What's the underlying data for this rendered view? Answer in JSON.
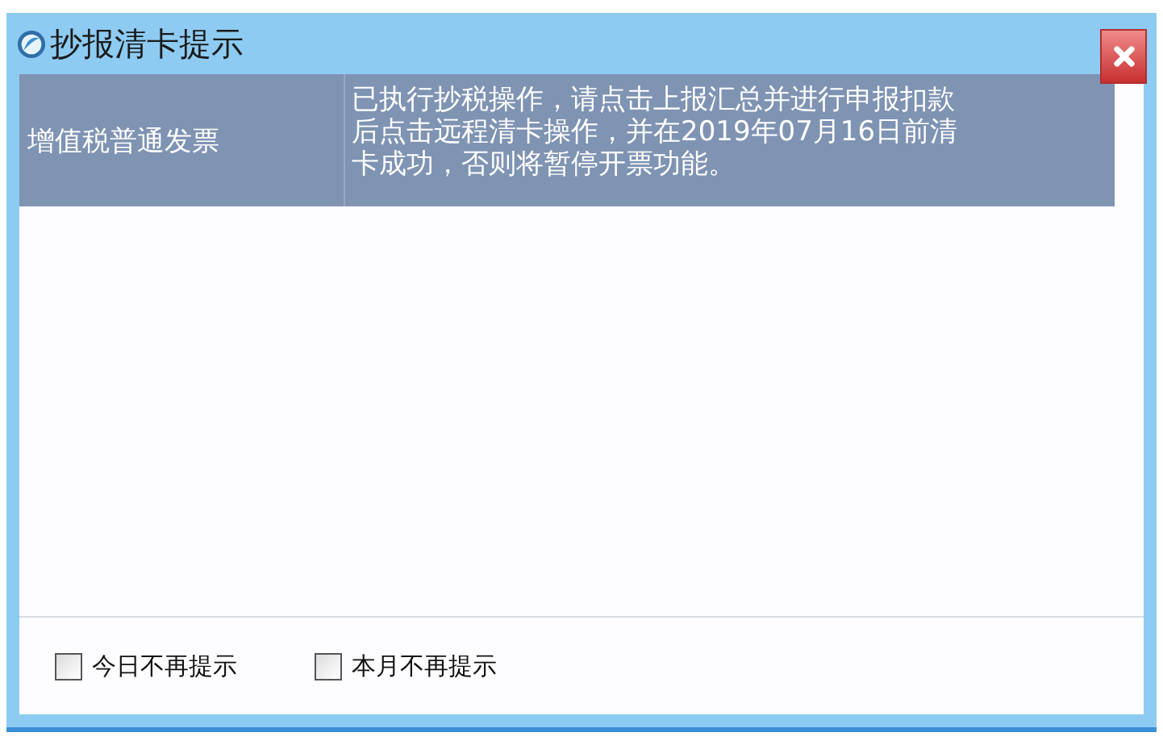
{
  "window": {
    "title": "抄报清卡提示"
  },
  "table": {
    "rows": [
      {
        "invoice_type": "增值税普通发票",
        "message": "已执行抄税操作，请点击上报汇总并进行申报扣款后点击远程清卡操作，并在2019年07月16日前清卡成功，否则将暂停开票功能。"
      }
    ]
  },
  "options": [
    {
      "label": "今日不再提示",
      "checked": false
    },
    {
      "label": "本月不再提示",
      "checked": false
    }
  ]
}
